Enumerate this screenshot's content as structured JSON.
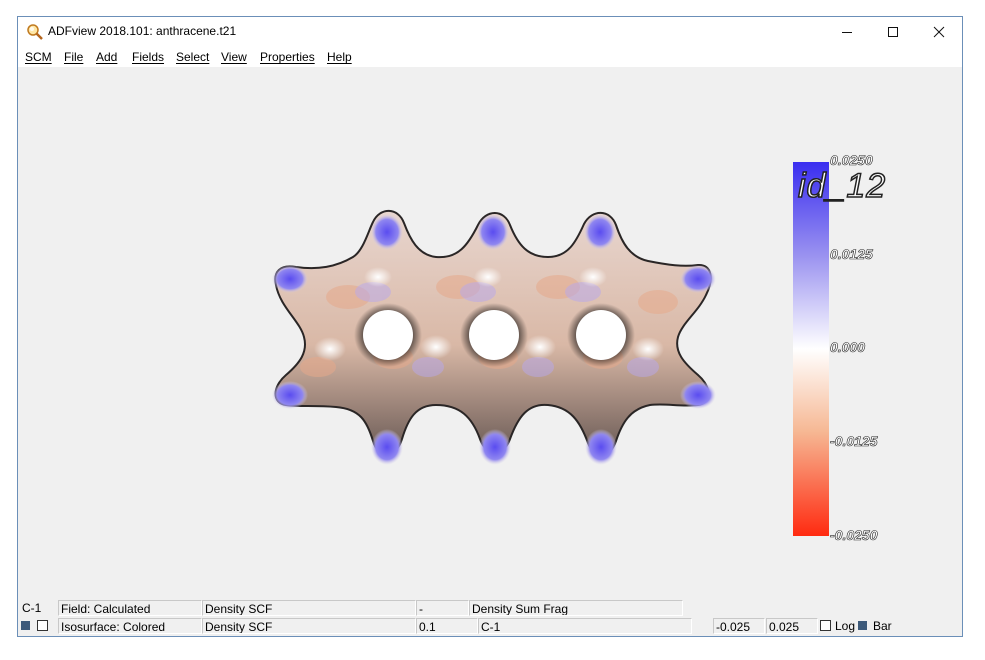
{
  "window": {
    "title": "ADFview 2018.101: anthracene.t21",
    "controls": {
      "minimize": "—",
      "maximize": "☐",
      "close": "✕"
    }
  },
  "menu": {
    "items": [
      "SCM",
      "File",
      "Add",
      "Fields",
      "Select",
      "View",
      "Properties",
      "Help"
    ]
  },
  "viewport": {
    "legend": {
      "title": "id_12",
      "labels": [
        "0.0250",
        "0.0125",
        "0.000",
        "-0.0125",
        "-0.0250"
      ],
      "colors": {
        "top": "#3a2ef0",
        "middle": "#ffffff",
        "bottom": "#ff2a10"
      }
    }
  },
  "status": {
    "row1": {
      "atom": "C-1",
      "field": "Field: Calculated",
      "density": "Density SCF",
      "dash": "-",
      "sum_frag": "Density Sum Frag"
    },
    "row2": {
      "isosurface": "Isosurface: Colored",
      "density": "Density SCF",
      "iso_value": "0.1",
      "atom": "C-1",
      "min": "-0.025",
      "max": "0.025",
      "log_label": "Log",
      "bar_label": "Bar"
    }
  }
}
